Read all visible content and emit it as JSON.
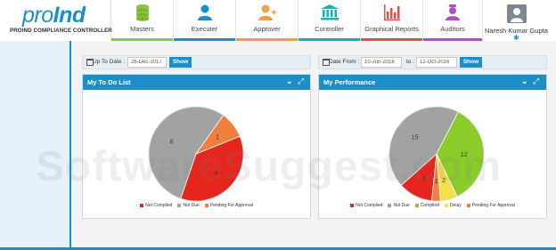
{
  "logo": {
    "text_main": "proInd",
    "subtitle": "PROIND COMPLIANCE CONTROLLER"
  },
  "nav": [
    {
      "label": "Masters",
      "icon": "database-icon",
      "color": "#8dc63f"
    },
    {
      "label": "Executer",
      "icon": "person-icon",
      "color": "#1d8fc7"
    },
    {
      "label": "Approver",
      "icon": "person-add-icon",
      "color": "#f0a04b"
    },
    {
      "label": "Controller",
      "icon": "bank-icon",
      "color": "#17b2b8"
    },
    {
      "label": "Graphical Reports",
      "icon": "bar-chart-icon",
      "color": "#d9534f"
    },
    {
      "label": "Auditors",
      "icon": "auditor-icon",
      "color": "#b04fc9"
    }
  ],
  "user": {
    "name": "Naresh Kumar Gupta",
    "icon": "gear-icon"
  },
  "todo": {
    "filter_label": "Up To Date :",
    "date_value": "26-Dec-2017",
    "show_label": "Show",
    "title": "My To Do List"
  },
  "performance": {
    "from_label": "Date From :",
    "from_value": "10-Jun-2016",
    "to_label": "to :",
    "to_value": "12-Oct-2016",
    "show_label": "Show",
    "title": "My Performance"
  },
  "watermark": "SoftwareSuggest.com",
  "chart_data": [
    {
      "type": "pie",
      "title": "My To Do List",
      "categories": [
        "Not Complied",
        "Not Due",
        "Pending For Approval"
      ],
      "values": [
        4,
        6,
        1
      ],
      "labels": [
        "4",
        "6",
        "1"
      ],
      "colors": [
        "#e5261f",
        "#a2a2a2",
        "#f07f3c"
      ]
    },
    {
      "type": "pie",
      "title": "My Performance",
      "categories": [
        "Not Complied",
        "Not Due",
        "Complied",
        "Delay",
        "Pending For Approval"
      ],
      "values": [
        4,
        15,
        12,
        2,
        1
      ],
      "labels": [
        "4",
        "15",
        "12",
        "2",
        "1"
      ],
      "colors": [
        "#e5261f",
        "#a2a2a2",
        "#8bcc2a",
        "#f2e14a",
        "#f07f3c"
      ]
    }
  ]
}
